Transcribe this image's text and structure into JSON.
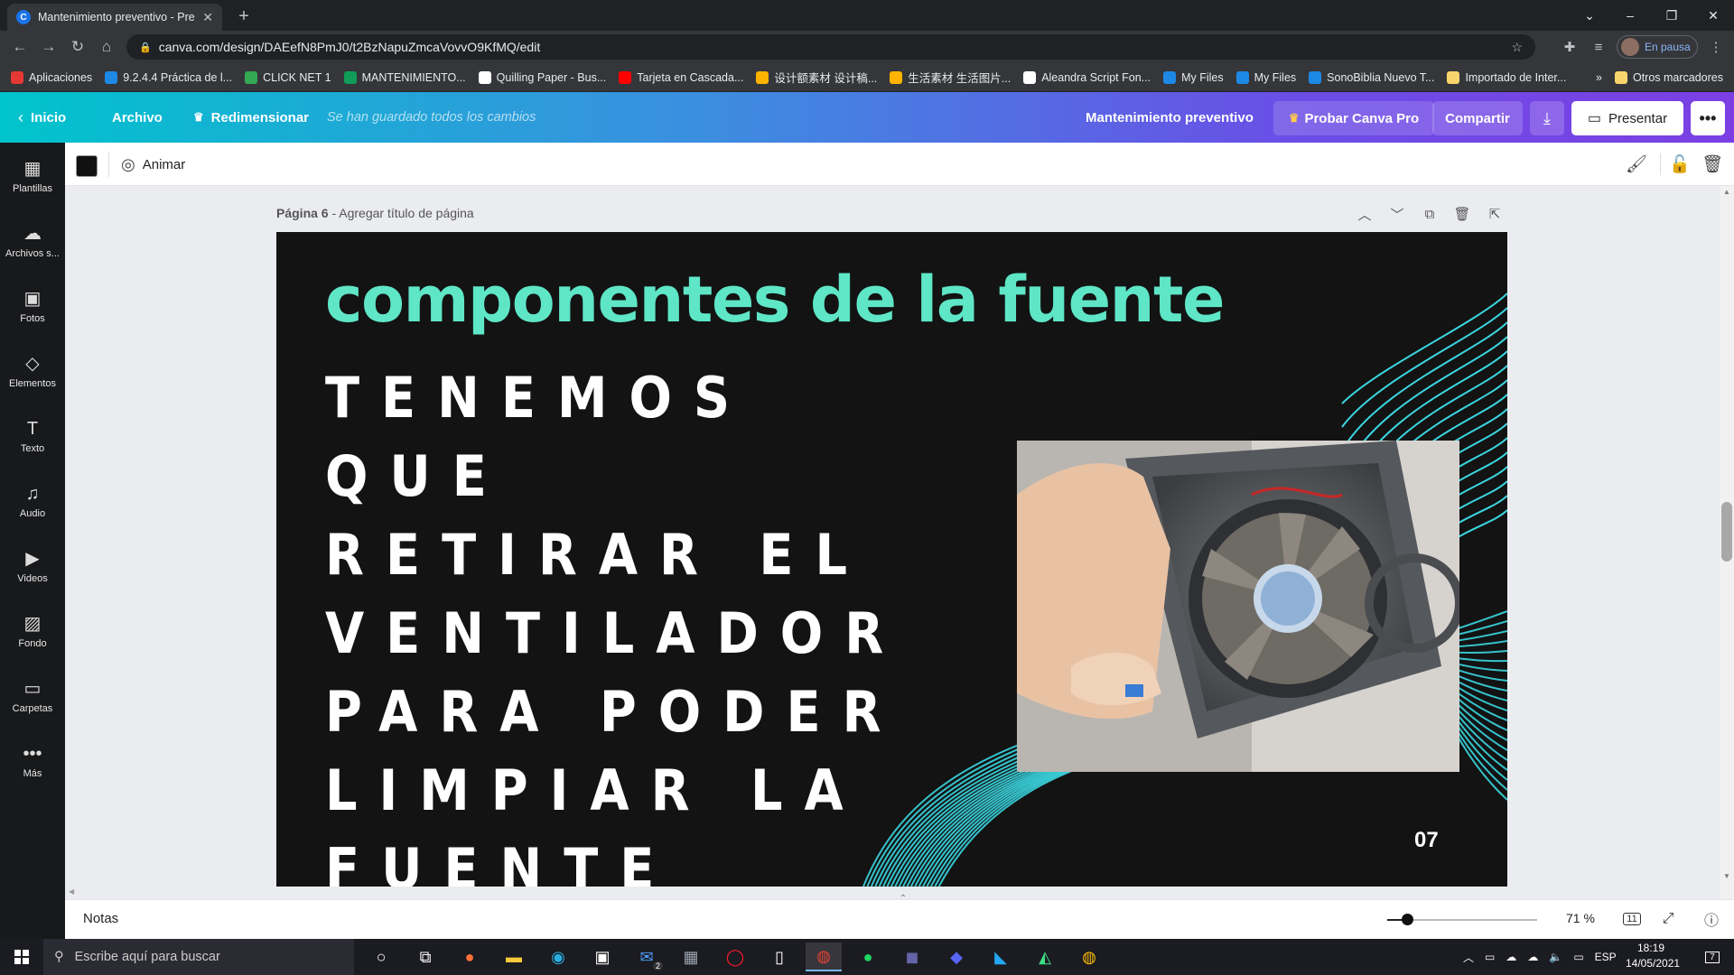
{
  "browser": {
    "tab_title": "Mantenimiento preventivo - Pres",
    "tab_favicon": "C",
    "url": "canva.com/design/DAEefN8PmJ0/t2BzNapuZmcaVovvO9KfMQ/edit",
    "profile_status": "En pausa",
    "bookmarks": [
      {
        "label": "Aplicaciones",
        "icon": "apps-grid-icon",
        "color": "#e53935"
      },
      {
        "label": "9.2.4.4 Práctica de l...",
        "icon": "netacad-icon",
        "color": "#1e88e5"
      },
      {
        "label": "CLICK NET 1",
        "icon": "google-drive-icon",
        "color": "#34a853"
      },
      {
        "label": "MANTENIMIENTO...",
        "icon": "google-sheets-icon",
        "color": "#0f9d58"
      },
      {
        "label": "Quilling Paper - Bus...",
        "icon": "google-icon",
        "color": "#ffffff"
      },
      {
        "label": "Tarjeta en Cascada...",
        "icon": "youtube-icon",
        "color": "#ff0000"
      },
      {
        "label": "设计额素材 设计稿...",
        "icon": "site-icon",
        "color": "#ffb300"
      },
      {
        "label": "生活素材 生活图片...",
        "icon": "site-icon",
        "color": "#ffb300"
      },
      {
        "label": "Aleandra Script Fon...",
        "icon": "globe-icon",
        "color": "#ffffff"
      },
      {
        "label": "My Files",
        "icon": "cloud-icon",
        "color": "#1e88e5"
      },
      {
        "label": "My Files",
        "icon": "cloud-icon",
        "color": "#1e88e5"
      },
      {
        "label": "SonoBiblia Nuevo T...",
        "icon": "cloud-icon",
        "color": "#1e88e5"
      },
      {
        "label": "Importado de Inter...",
        "icon": "folder-icon",
        "color": "#f9d56e"
      }
    ],
    "bookmarks_overflow": "»",
    "other_bookmarks": "Otros marcadores"
  },
  "header": {
    "home": "Inicio",
    "file": "Archivo",
    "resize": "Redimensionar",
    "saved_status": "Se han guardado todos los cambios",
    "doc_title": "Mantenimiento preventivo",
    "try_pro": "Probar Canva Pro",
    "share": "Compartir",
    "present": "Presentar"
  },
  "sidebar": [
    {
      "label": "Plantillas",
      "icon": "templates-icon",
      "glyph": "▦"
    },
    {
      "label": "Archivos s...",
      "icon": "upload-cloud-icon",
      "glyph": "☁"
    },
    {
      "label": "Fotos",
      "icon": "photos-icon",
      "glyph": "▣"
    },
    {
      "label": "Elementos",
      "icon": "elements-icon",
      "glyph": "◇"
    },
    {
      "label": "Texto",
      "icon": "text-icon",
      "glyph": "T"
    },
    {
      "label": "Audio",
      "icon": "music-note-icon",
      "glyph": "♫"
    },
    {
      "label": "Videos",
      "icon": "video-icon",
      "glyph": "▶"
    },
    {
      "label": "Fondo",
      "icon": "background-pattern-icon",
      "glyph": "▨"
    },
    {
      "label": "Carpetas",
      "icon": "folder-icon",
      "glyph": "▭"
    },
    {
      "label": "Más",
      "icon": "more-dots-icon",
      "glyph": "•••"
    }
  ],
  "toolbar": {
    "animate": "Animar",
    "color_swatch": "#111111"
  },
  "page": {
    "number_label": "Página 6",
    "separator": " - ",
    "title_placeholder": "Agregar título de página"
  },
  "slide": {
    "title": "componentes de la fuente",
    "body": "Tenemos que retirar el ventilador para poder limpiar la fuente",
    "page_number": "07",
    "title_color": "#5ee6c6",
    "background": "#131313",
    "accent_lines": "#3bd6e0"
  },
  "bottom": {
    "notes": "Notas",
    "zoom": "71 %",
    "zoom_level": 0.08,
    "page_count": "11"
  },
  "taskbar": {
    "search_placeholder": "Escribe aquí para buscar",
    "language": "ESP",
    "time": "18:19",
    "date": "14/05/2021",
    "notification_count": "7",
    "mail_badge": "2"
  }
}
